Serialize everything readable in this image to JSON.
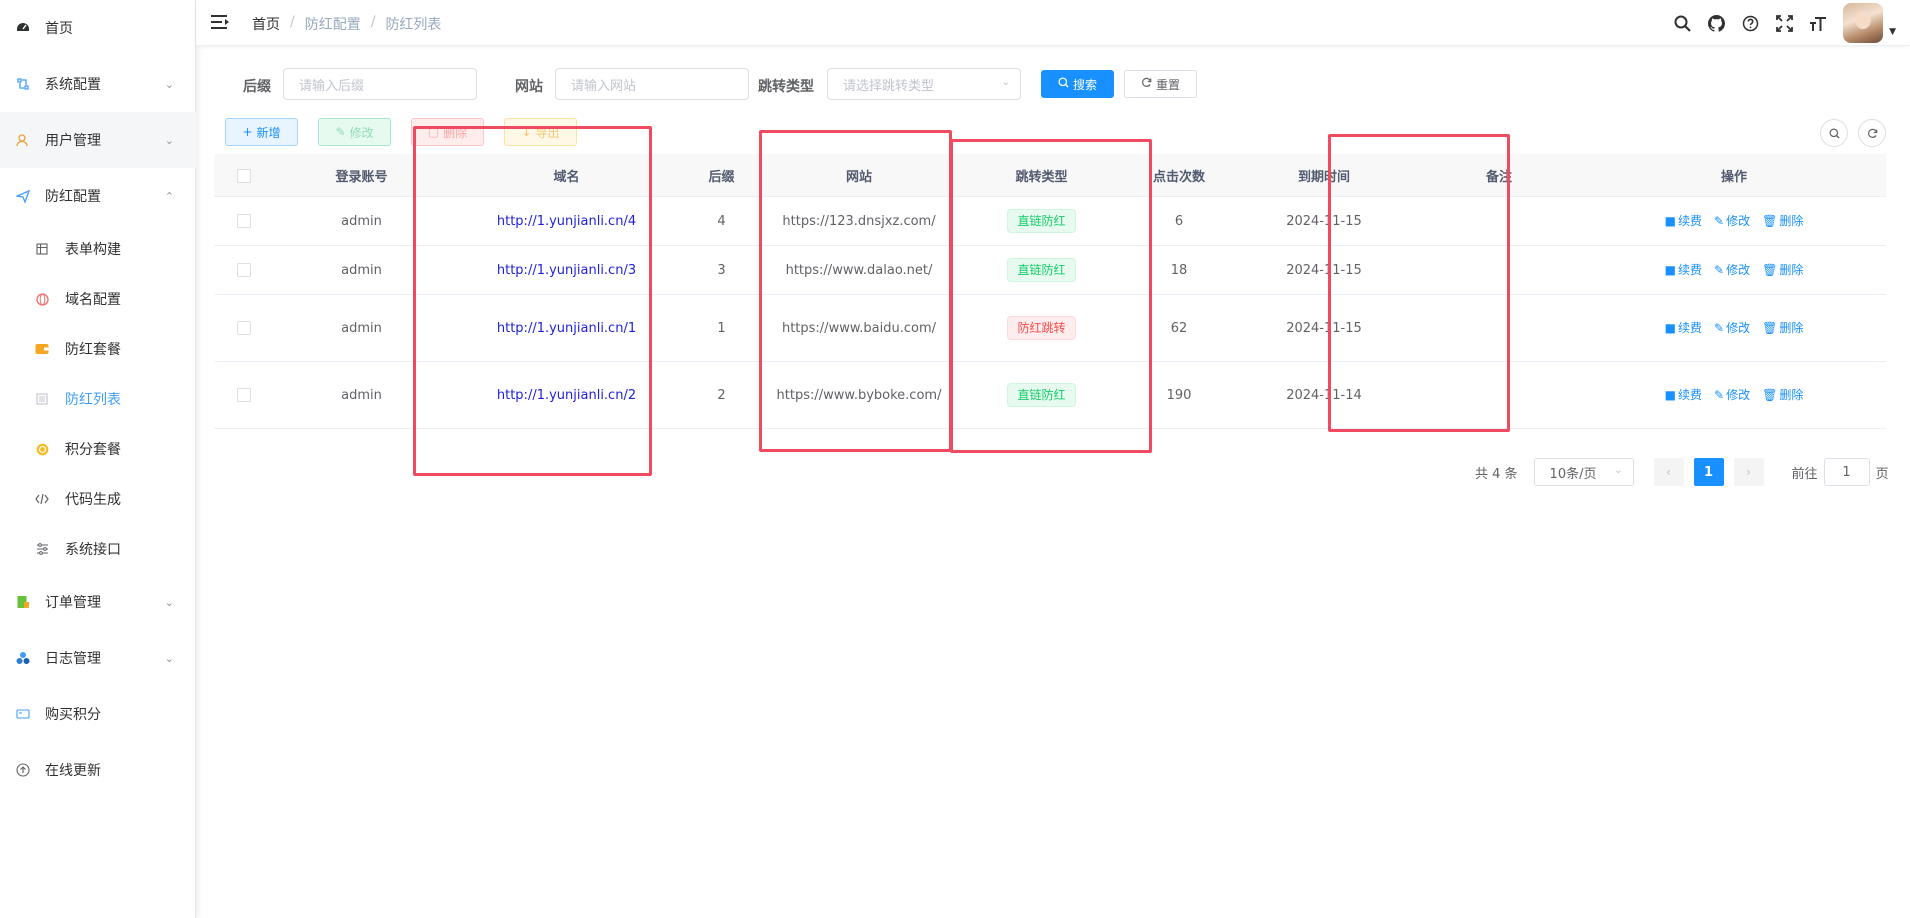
{
  "sidebar": {
    "items": [
      {
        "label": "首页",
        "icon": "dashboard-icon"
      },
      {
        "label": "系统配置",
        "icon": "system-icon"
      },
      {
        "label": "用户管理",
        "icon": "user-icon"
      },
      {
        "label": "防红配置",
        "icon": "send-icon"
      },
      {
        "label": "订单管理",
        "icon": "order-icon"
      },
      {
        "label": "日志管理",
        "icon": "log-icon"
      },
      {
        "label": "购买积分",
        "icon": "points-icon"
      },
      {
        "label": "在线更新",
        "icon": "update-icon"
      }
    ],
    "sub_items": [
      {
        "label": "表单构建",
        "icon": "form-icon"
      },
      {
        "label": "域名配置",
        "icon": "domain-icon"
      },
      {
        "label": "防红套餐",
        "icon": "package-icon"
      },
      {
        "label": "防红列表",
        "icon": "list-icon"
      },
      {
        "label": "积分套餐",
        "icon": "coin-icon"
      },
      {
        "label": "代码生成",
        "icon": "code-icon"
      },
      {
        "label": "系统接口",
        "icon": "api-icon"
      }
    ]
  },
  "breadcrumb": [
    "首页",
    "防红配置",
    "防红列表"
  ],
  "search": {
    "suffix_label": "后缀",
    "suffix_placeholder": "请输入后缀",
    "site_label": "网站",
    "site_placeholder": "请输入网站",
    "type_label": "跳转类型",
    "type_placeholder": "请选择跳转类型",
    "search_button": "搜索",
    "reset_button": "重置"
  },
  "toolbar": {
    "add": "新增",
    "edit": "修改",
    "delete": "删除",
    "export": "导出"
  },
  "table": {
    "columns": [
      "登录账号",
      "域名",
      "后缀",
      "网站",
      "跳转类型",
      "点击次数",
      "到期时间",
      "备注",
      "操作"
    ],
    "rows": [
      {
        "account": "admin",
        "domain": "http://1.yunjianli.cn/4",
        "suffix": "4",
        "site": "https://123.dnsjxz.com/",
        "type": "直链防红",
        "type_status": "success",
        "clicks": "6",
        "expire": "2024-11-15",
        "remark": ""
      },
      {
        "account": "admin",
        "domain": "http://1.yunjianli.cn/3",
        "suffix": "3",
        "site": "https://www.dalao.net/",
        "type": "直链防红",
        "type_status": "success",
        "clicks": "18",
        "expire": "2024-11-15",
        "remark": ""
      },
      {
        "account": "admin",
        "domain": "http://1.yunjianli.cn/1",
        "suffix": "1",
        "site": "https://www.baidu.com/",
        "type": "防红跳转",
        "type_status": "danger",
        "clicks": "62",
        "expire": "2024-11-15",
        "remark": ""
      },
      {
        "account": "admin",
        "domain": "http://1.yunjianli.cn/2",
        "suffix": "2",
        "site": "https://www.byboke.com/",
        "type": "直链防红",
        "type_status": "success",
        "clicks": "190",
        "expire": "2024-11-14",
        "remark": ""
      }
    ],
    "actions": {
      "renew": "续费",
      "edit": "修改",
      "delete": "删除"
    }
  },
  "pagination": {
    "total": "共 4 条",
    "page_size": "10条/页",
    "current_page": "1",
    "goto_label": "前往",
    "goto_value": "1",
    "page_suffix": "页"
  },
  "colors": {
    "primary": "#1890ff",
    "success": "#13ce66",
    "danger": "#ff4949",
    "highlight": "#ef4a5f"
  }
}
